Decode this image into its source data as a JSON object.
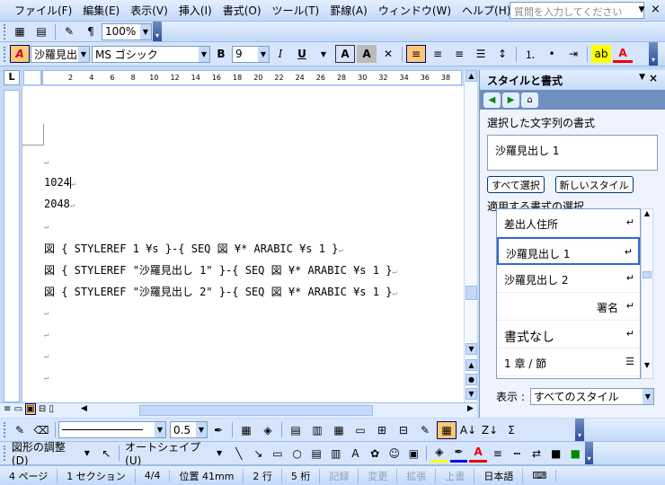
{
  "menu": [
    "ファイル(F)",
    "編集(E)",
    "表示(V)",
    "挿入(I)",
    "書式(O)",
    "ツール(T)",
    "罫線(A)",
    "ウィンドウ(W)",
    "ヘルプ(H)"
  ],
  "help_placeholder": "質問を入力してください",
  "toolbar1": {
    "zoom": "100%"
  },
  "toolbar2": {
    "style": "沙羅見出し",
    "font": "MS ゴシック",
    "size": "9"
  },
  "ruler_marks": [
    "2",
    "4",
    "6",
    "8",
    "10",
    "12",
    "14",
    "16",
    "18",
    "20",
    "22",
    "24",
    "26",
    "28",
    "30",
    "32",
    "34",
    "36",
    "38"
  ],
  "document": {
    "lines": [
      "",
      "1024",
      "2048",
      "",
      "図 { STYLEREF 1 ¥s }-{ SEQ 図 ¥* ARABIC ¥s 1 }",
      "図 { STYLEREF \"沙羅見出し 1\" }-{ SEQ 図 ¥* ARABIC ¥s 1 }",
      "図 { STYLEREF \"沙羅見出し 2\" }-{ SEQ 図 ¥* ARABIC ¥s 1 }",
      "",
      "",
      "",
      ""
    ]
  },
  "pane": {
    "title": "スタイルと書式",
    "selected_label": "選択した文字列の書式",
    "current_style": "沙羅見出し 1",
    "select_all": "すべて選択",
    "new_style": "新しいスタイル",
    "apply_label": "適用する書式の選択",
    "styles": [
      "差出人住所",
      "沙羅見出し 1",
      "沙羅見出し 2",
      "署名",
      "書式なし",
      "1 章 / 節"
    ],
    "show_label": "表示 :",
    "show_value": "すべてのスタイル"
  },
  "toolbar3": {
    "line_width": "0.5"
  },
  "toolbar4": {
    "drawing": "図形の調整(D)",
    "autoshape": "オートシェイプ(U)"
  },
  "status": [
    "4 ページ",
    "1 セクション",
    "4/4",
    "位置 41mm",
    "2 行",
    "5 桁",
    "記録",
    "変更",
    "拡張",
    "上書",
    "日本語"
  ],
  "colors": {
    "accent": "#3168d5",
    "bar": "#c4daf8"
  }
}
